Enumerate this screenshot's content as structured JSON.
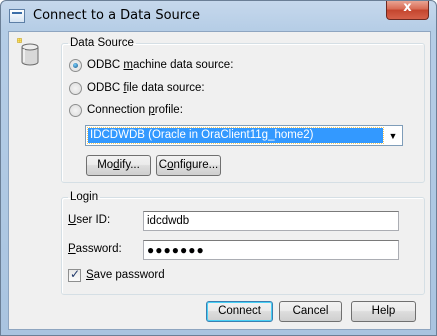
{
  "window": {
    "title": "Connect to a Data Source",
    "close_glyph": "x"
  },
  "data_source": {
    "legend": "Data Source",
    "options": [
      {
        "label_pre": "ODBC ",
        "label_accel": "m",
        "label_post": "achine data source:",
        "selected": true
      },
      {
        "label_pre": "ODBC ",
        "label_accel": "f",
        "label_post": "ile data source:",
        "selected": false
      },
      {
        "label_pre": "Connection ",
        "label_accel": "p",
        "label_post": "rofile:",
        "selected": false
      }
    ],
    "profile_value": "IDCDWDB (Oracle in OraClient11g_home2)",
    "modify": {
      "pre": "Mo",
      "accel": "d",
      "post": "ify..."
    },
    "configure": {
      "pre": "C",
      "accel": "o",
      "post": "nfigure..."
    }
  },
  "login": {
    "legend": "Login",
    "user_id_label": {
      "accel": "U",
      "post": "ser ID:"
    },
    "user_id_value": "idcdwdb",
    "password_label": {
      "accel": "P",
      "post": "assword:"
    },
    "password_value": "●●●●●●●",
    "save_password": {
      "accel": "S",
      "post": "ave password",
      "checked": true
    }
  },
  "buttons": {
    "connect": "Connect",
    "cancel": "Cancel",
    "help": "Help"
  },
  "colors": {
    "title_gradient": "#b5cde6",
    "selection": "#3399ff",
    "close": "#c4452e"
  }
}
